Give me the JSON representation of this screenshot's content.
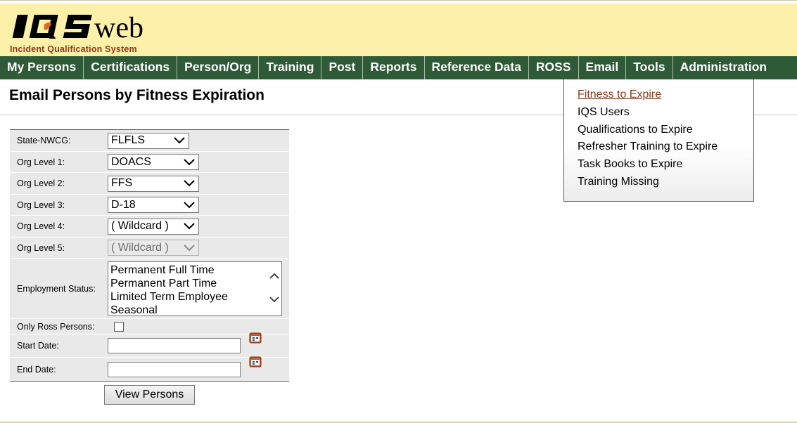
{
  "app": {
    "logo_text": "IQSweb",
    "logo_subtitle": "Incident Qualification System"
  },
  "nav": {
    "items": [
      {
        "label": "My Persons"
      },
      {
        "label": "Certifications"
      },
      {
        "label": "Person/Org"
      },
      {
        "label": "Training"
      },
      {
        "label": "Post"
      },
      {
        "label": "Reports"
      },
      {
        "label": "Reference Data"
      },
      {
        "label": "ROSS"
      },
      {
        "label": "Email"
      },
      {
        "label": "Tools"
      },
      {
        "label": "Administration"
      }
    ]
  },
  "email_menu": {
    "items": [
      {
        "label": "Fitness to Expire"
      },
      {
        "label": "IQS Users"
      },
      {
        "label": "Qualifications to Expire"
      },
      {
        "label": "Refresher Training to Expire"
      },
      {
        "label": "Task Books to Expire"
      },
      {
        "label": "Training Missing"
      }
    ]
  },
  "page": {
    "title": "Email Persons by Fitness Expiration"
  },
  "form": {
    "state_label": "State-NWCG:",
    "state_value": "FLFLS",
    "org1_label": "Org Level 1:",
    "org1_value": "DOACS",
    "org2_label": "Org Level 2:",
    "org2_value": "FFS",
    "org3_label": "Org Level 3:",
    "org3_value": "D-18",
    "org4_label": "Org Level 4:",
    "org4_value": "( Wildcard )",
    "org5_label": "Org Level 5:",
    "org5_value": "( Wildcard )",
    "employment_label": "Employment Status:",
    "employment_options": [
      "Permanent Full Time",
      "Permanent Part Time",
      "Limited Term Employee",
      "Seasonal"
    ],
    "ross_label": "Only Ross Persons:",
    "start_label": "Start Date:",
    "start_value": "",
    "end_label": "End Date:",
    "end_value": "",
    "submit_label": "View Persons"
  },
  "colors": {
    "header_bg": "#fdf0a8",
    "nav_bg": "#2e5a37",
    "accent": "#8a3a1a",
    "row_bg": "#e9e9e9"
  }
}
